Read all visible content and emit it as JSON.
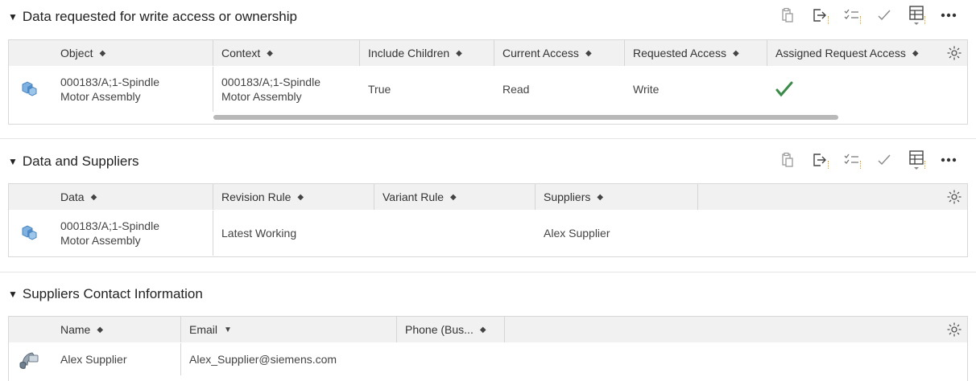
{
  "sections": [
    {
      "title": "Data requested for write access or ownership",
      "columns": [
        "Object",
        "Context",
        "Include Children",
        "Current Access",
        "Requested Access",
        "Assigned Request Access"
      ],
      "row": {
        "object": "000183/A;1-Spindle Motor Assembly",
        "object_l1": "000183/A;1-Spindle",
        "object_l2": "Motor Assembly",
        "context_l1": "000183/A;1-Spindle",
        "context_l2": "Motor Assembly",
        "include_children": "True",
        "current_access": "Read",
        "requested_access": "Write",
        "assigned_request_access": "checked"
      }
    },
    {
      "title": "Data and Suppliers",
      "columns": [
        "Data",
        "Revision Rule",
        "Variant Rule",
        "Suppliers"
      ],
      "row": {
        "data_l1": "000183/A;1-Spindle",
        "data_l2": "Motor Assembly",
        "revision_rule": "Latest Working",
        "variant_rule": "",
        "suppliers": "Alex Supplier"
      }
    },
    {
      "title": "Suppliers Contact Information",
      "columns": [
        "Name",
        "Email",
        "Phone (Bus..."
      ],
      "row": {
        "name": "Alex Supplier",
        "email": "Alex_Supplier@siemens.com",
        "phone": ""
      }
    }
  ],
  "toolbar_icons": [
    "paste-icon",
    "export-icon",
    "checklist-icon",
    "check-icon",
    "table-layout-icon",
    "more-icon"
  ],
  "colors": {
    "header_bg": "#f1f1f1",
    "check": "#3c8a4a",
    "icon_blue": "#5b9bd5"
  }
}
